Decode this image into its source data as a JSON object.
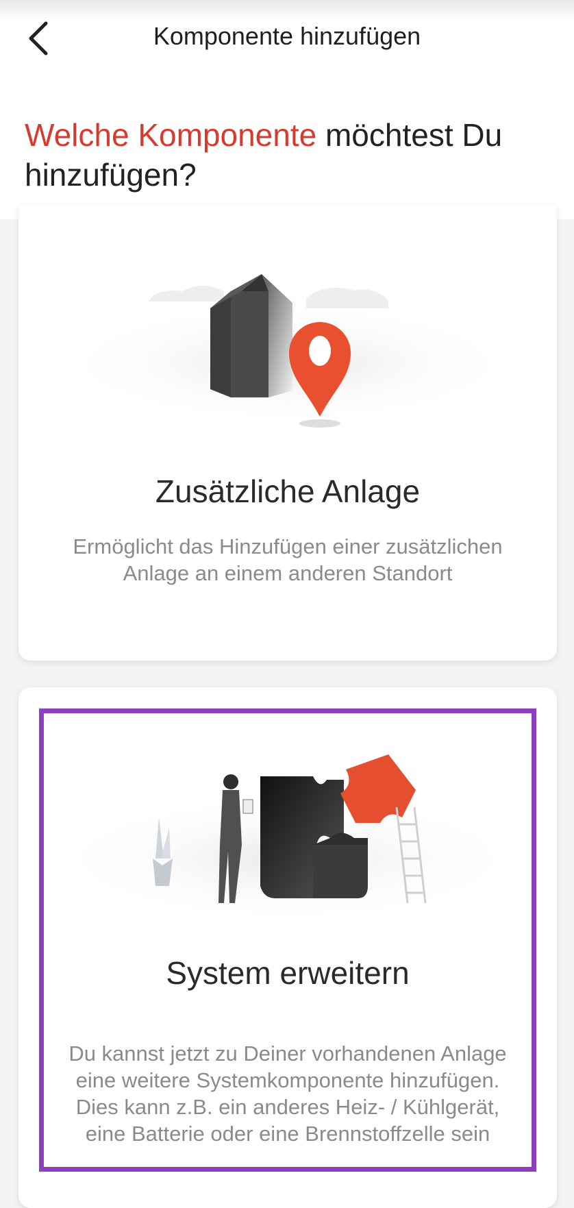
{
  "header": {
    "title": "Komponente hinzufügen",
    "back_icon": "chevron-left-icon"
  },
  "question": {
    "accent": "Welche Komponente",
    "rest": " möchtest Du hinzufügen?"
  },
  "cards": [
    {
      "title": "Zusätzliche Anlage",
      "description": "Ermöglicht das Hinzufügen einer zusätzlichen Anlage an einem anderen Standort",
      "illustration": "house-location-pin-illustration"
    },
    {
      "title": "System erweitern",
      "description": "Du kannst jetzt zu Deiner vorhandenen Anlage eine weitere Systemkomponente hinzufügen. Dies kann z.B. ein anderes Heiz- / Kühlgerät, eine Batterie oder eine Brennstoffzelle sein",
      "illustration": "puzzle-person-illustration",
      "highlighted": true
    }
  ],
  "colors": {
    "accent": "#d63b2f",
    "highlight": "#8d3fbf",
    "background": "#f4f4f4"
  }
}
